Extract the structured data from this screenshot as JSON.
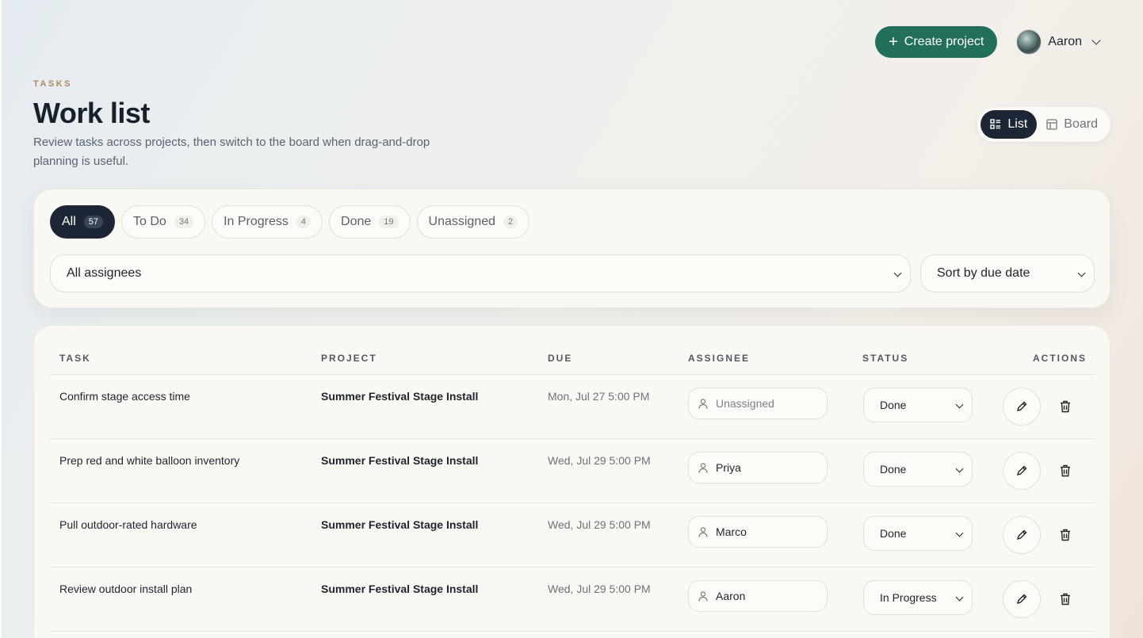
{
  "header": {
    "create_label": "Create project",
    "user_name": "Aaron",
    "eyebrow": "TASKS",
    "title": "Work list",
    "subtitle": "Review tasks across projects, then switch to the board when drag-and-drop planning is useful."
  },
  "view_toggle": {
    "list_label": "List",
    "board_label": "Board",
    "active": "List"
  },
  "filters": {
    "chips": [
      {
        "label": "All",
        "count": "57",
        "active": true
      },
      {
        "label": "To Do",
        "count": "34",
        "active": false
      },
      {
        "label": "In Progress",
        "count": "4",
        "active": false
      },
      {
        "label": "Done",
        "count": "19",
        "active": false
      },
      {
        "label": "Unassigned",
        "count": "2",
        "active": false
      }
    ],
    "assignee_select": "All assignees",
    "sort_select": "Sort by due date"
  },
  "table": {
    "columns": [
      "TASK",
      "PROJECT",
      "DUE",
      "ASSIGNEE",
      "STATUS",
      "ACTIONS"
    ],
    "rows": [
      {
        "task": "Confirm stage access time",
        "project": "Summer Festival Stage Install",
        "due": "Mon, Jul 27 5:00 PM",
        "assignee": "Unassigned",
        "status": "Done"
      },
      {
        "task": "Prep red and white balloon inventory",
        "project": "Summer Festival Stage Install",
        "due": "Wed, Jul 29 5:00 PM",
        "assignee": "Priya",
        "status": "Done"
      },
      {
        "task": "Pull outdoor-rated hardware",
        "project": "Summer Festival Stage Install",
        "due": "Wed, Jul 29 5:00 PM",
        "assignee": "Marco",
        "status": "Done"
      },
      {
        "task": "Review outdoor install plan",
        "project": "Summer Festival Stage Install",
        "due": "Wed, Jul 29 5:00 PM",
        "assignee": "Aaron",
        "status": "In Progress"
      }
    ]
  },
  "colors": {
    "accent": "#236f5c",
    "dark": "#1c2634",
    "eyebrow": "#b08a58",
    "card": "#faf8f3"
  },
  "icons": [
    "plus-icon",
    "chevron-down-icon",
    "list-icon",
    "board-icon",
    "user-icon",
    "pencil-icon",
    "trash-icon"
  ]
}
